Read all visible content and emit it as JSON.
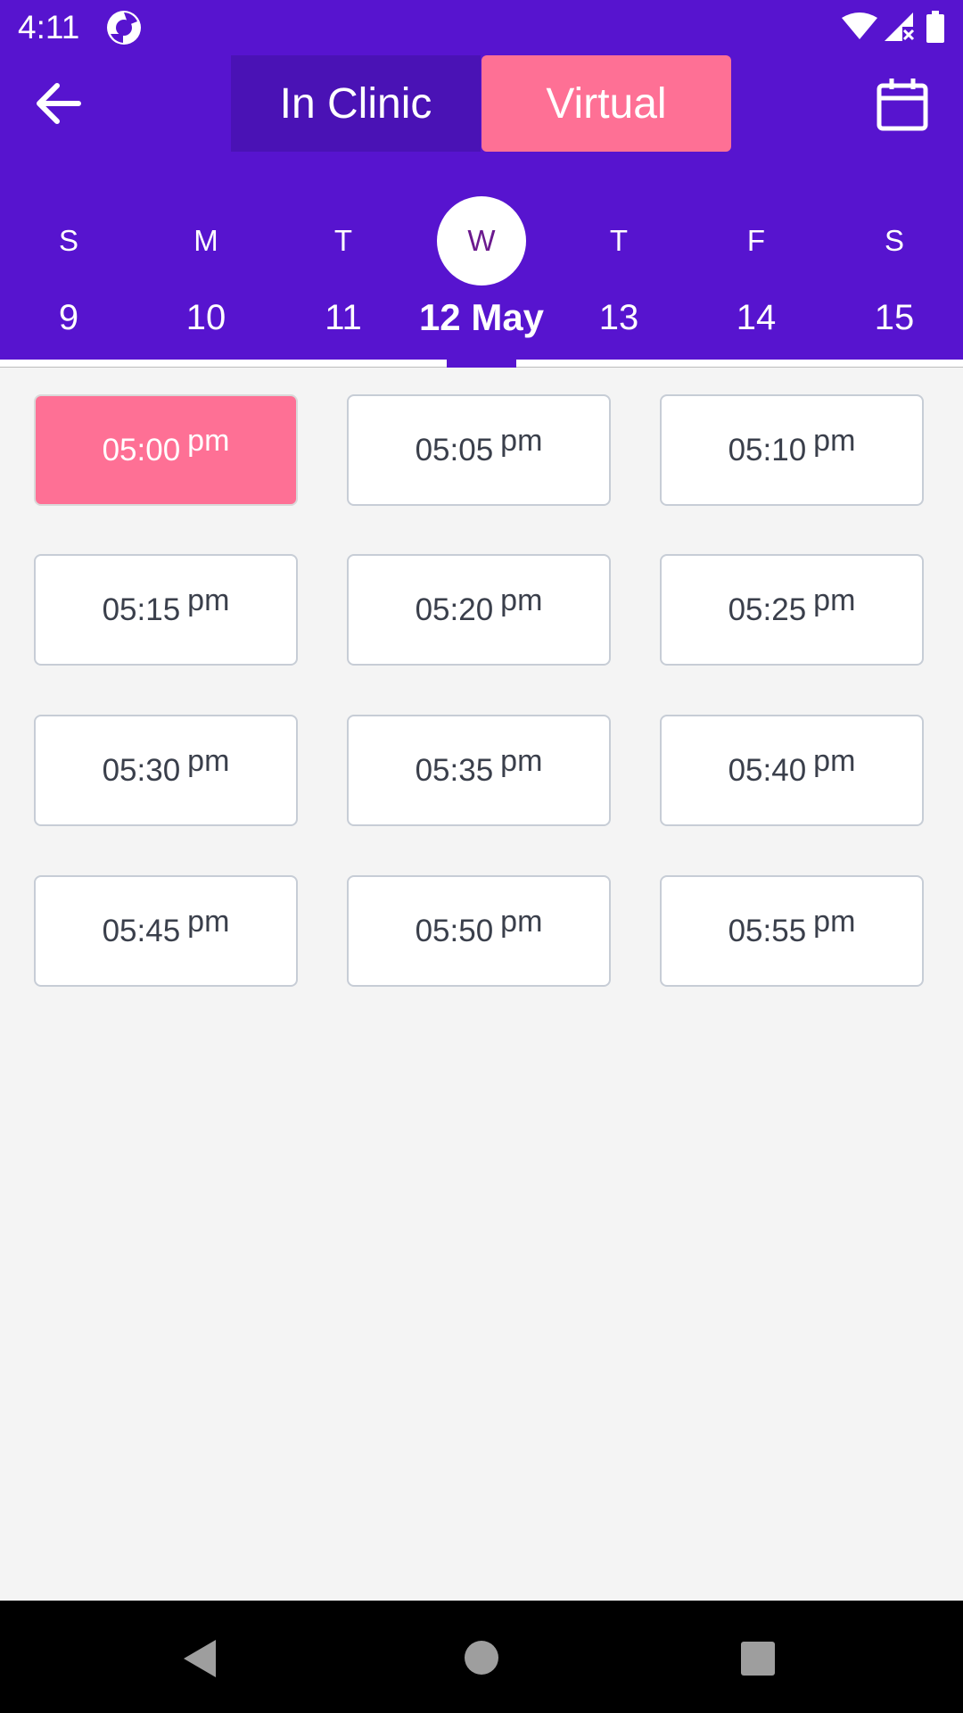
{
  "status_bar": {
    "time": "4:11",
    "icons": [
      "app-notification-icon",
      "wifi-icon",
      "signal-icon",
      "battery-icon"
    ]
  },
  "header": {
    "back_icon": "arrow-left-icon",
    "calendar_icon": "calendar-icon",
    "tabs": [
      {
        "label": "In Clinic",
        "selected": false
      },
      {
        "label": "Virtual",
        "selected": true
      }
    ]
  },
  "week": {
    "days": [
      {
        "letter": "S",
        "date": "9"
      },
      {
        "letter": "M",
        "date": "10"
      },
      {
        "letter": "T",
        "date": "11"
      },
      {
        "letter": "W",
        "date": "12 May",
        "selected": true
      },
      {
        "letter": "T",
        "date": "13"
      },
      {
        "letter": "F",
        "date": "14"
      },
      {
        "letter": "S",
        "date": "15"
      }
    ]
  },
  "slots": [
    {
      "time": "05:00",
      "period": "pm",
      "selected": true
    },
    {
      "time": "05:05",
      "period": "pm"
    },
    {
      "time": "05:10",
      "period": "pm"
    },
    {
      "time": "05:15",
      "period": "pm"
    },
    {
      "time": "05:20",
      "period": "pm"
    },
    {
      "time": "05:25",
      "period": "pm"
    },
    {
      "time": "05:30",
      "period": "pm"
    },
    {
      "time": "05:35",
      "period": "pm"
    },
    {
      "time": "05:40",
      "period": "pm"
    },
    {
      "time": "05:45",
      "period": "pm"
    },
    {
      "time": "05:50",
      "period": "pm"
    },
    {
      "time": "05:55",
      "period": "pm"
    }
  ],
  "colors": {
    "header": "#5714cf",
    "accent": "#fe7095",
    "inactive_tab": "#4a12b5"
  },
  "nav_bar": {
    "icons": [
      "nav-back-icon",
      "nav-home-icon",
      "nav-recents-icon"
    ]
  }
}
